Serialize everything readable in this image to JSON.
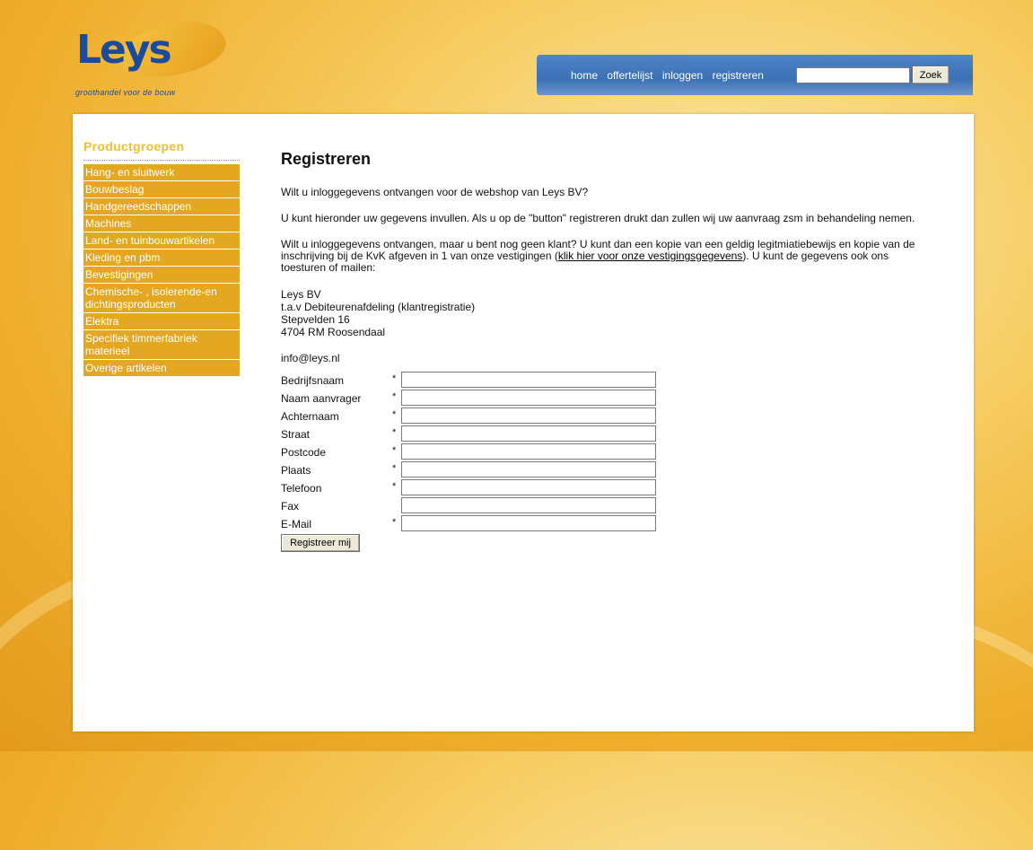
{
  "logo": {
    "word": "Leys",
    "tagline": "groothandel voor de bouw"
  },
  "nav": {
    "links": [
      "home",
      "offertelijst",
      "inloggen",
      "registreren"
    ],
    "search_value": "",
    "search_button": "Zoek"
  },
  "sidebar": {
    "title": "Productgroepen",
    "items": [
      "Hang- en sluitwerk",
      "Bouwbeslag",
      "Handgereedschappen",
      "Machines",
      "Land- en tuinbouwartikelen",
      "Kleding en pbm",
      "Bevestigingen",
      "Chemische- , isolerende-en dichtingsproducten",
      "Elektra",
      "Specifiek timmerfabriek materieel",
      "Overige artikelen"
    ]
  },
  "main": {
    "heading": "Registreren",
    "intro": "Wilt u inloggegevens ontvangen voor de webshop van Leys BV?",
    "paragraph2": "U kunt hieronder uw gegevens invullen. Als u op de \"button\" registreren drukt dan zullen wij uw aanvraag zsm in behandeling nemen.",
    "paragraph3_before": "Wilt u inloggegevens ontvangen, maar u bent nog geen klant? U kunt dan een kopie van een geldig legitmiatiebewijs en kopie van de inschrijving bij de KvK afgeven in 1 van onze vestigingen (",
    "paragraph3_link": "klik hier voor onze vestigingsgegevens",
    "paragraph3_after": "). U kunt de gegevens ook ons toesturen of mailen:",
    "address": [
      "Leys BV",
      "t.a.v Debiteurenafdeling (klantregistratie)",
      "Stepvelden 16",
      "4704 RM Roosendaal"
    ],
    "email": "info@leys.nl",
    "form": {
      "fields": [
        {
          "label": "Bedrijfsnaam",
          "required": "*",
          "value": ""
        },
        {
          "label": "Naam aanvrager",
          "required": "*",
          "value": ""
        },
        {
          "label": "Achternaam",
          "required": "*",
          "value": ""
        },
        {
          "label": "Straat",
          "required": "*",
          "value": ""
        },
        {
          "label": "Postcode",
          "required": "*",
          "value": ""
        },
        {
          "label": "Plaats",
          "required": "*",
          "value": ""
        },
        {
          "label": "Telefoon",
          "required": "*",
          "value": ""
        },
        {
          "label": "Fax",
          "required": "",
          "value": ""
        },
        {
          "label": "E-Mail",
          "required": "*",
          "value": ""
        }
      ],
      "submit_label": "Registreer mij"
    }
  },
  "colors": {
    "brand_blue": "#1b4b9c",
    "sidebar_item": "#e4a722",
    "sidebar_title": "#f0c030",
    "nav_bar": "#3a70b4"
  }
}
